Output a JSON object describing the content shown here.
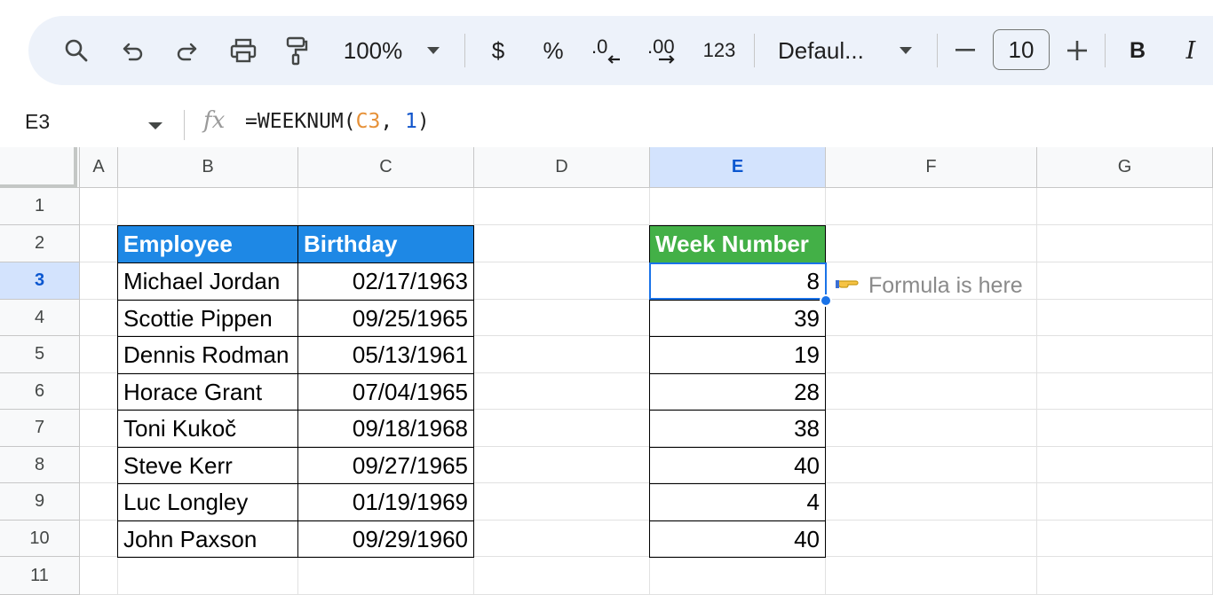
{
  "toolbar": {
    "zoom": "100%",
    "currency": "$",
    "percent": "%",
    "more_formats": "123",
    "font": "Defaul...",
    "font_size": "10",
    "bold": "B",
    "italic": "I"
  },
  "formula_bar": {
    "name_box": "E3",
    "fx": "fx",
    "formula_prefix": "=WEEKNUM(",
    "formula_ref": "C3",
    "formula_sep": ", ",
    "formula_num": "1",
    "formula_suffix": ")"
  },
  "columns": [
    "A",
    "B",
    "C",
    "D",
    "E",
    "F",
    "G"
  ],
  "rows": [
    "1",
    "2",
    "3",
    "4",
    "5",
    "6",
    "7",
    "8",
    "9",
    "10",
    "11"
  ],
  "table": {
    "header_employee": "Employee",
    "header_birthday": "Birthday",
    "header_week": "Week Number",
    "employees": [
      "Michael Jordan",
      "Scottie Pippen",
      "Dennis Rodman",
      "Horace Grant",
      "Toni Kukoč",
      "Steve Kerr",
      "Luc Longley",
      "John Paxson"
    ],
    "birthdays": [
      "02/17/1963",
      "09/25/1965",
      "05/13/1961",
      "07/04/1965",
      "09/18/1968",
      "09/27/1965",
      "01/19/1969",
      "09/29/1960"
    ],
    "weeks": [
      "8",
      "39",
      "19",
      "28",
      "38",
      "40",
      "4",
      "40"
    ]
  },
  "note": "Formula is here",
  "colors": {
    "employee_header": "#1e88e5",
    "week_header": "#43b047",
    "selection": "#1a73e8"
  }
}
